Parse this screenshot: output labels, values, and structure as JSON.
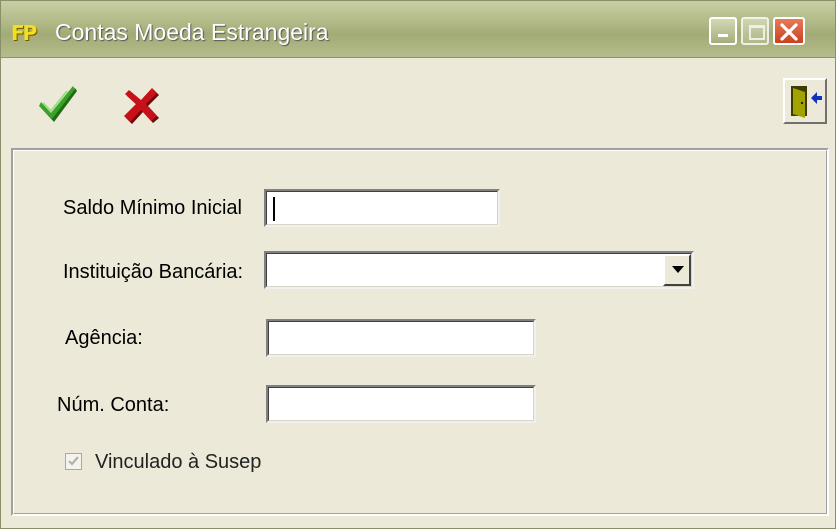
{
  "window": {
    "title": "Contas Moeda Estrangeira",
    "app_icon": "FP"
  },
  "toolbar": {
    "ok_icon": "green-check-icon",
    "cancel_icon": "red-x-icon",
    "exit_icon": "exit-door-icon"
  },
  "form": {
    "saldo_label": "Saldo Mínimo Inicial",
    "saldo_value": "",
    "instituicao_label": "Instituição Bancária:",
    "instituicao_value": "",
    "agencia_label": "Agência:",
    "agencia_value": "",
    "conta_label": "Núm. Conta:",
    "conta_value": "",
    "vinculado_label": "Vinculado à Susep",
    "vinculado_checked": true,
    "vinculado_enabled": false
  },
  "colors": {
    "titlebar": "#b0b885",
    "window_bg": "#ECE9D8",
    "ok_green": "#2e8b1e",
    "cancel_red": "#c8101a"
  }
}
